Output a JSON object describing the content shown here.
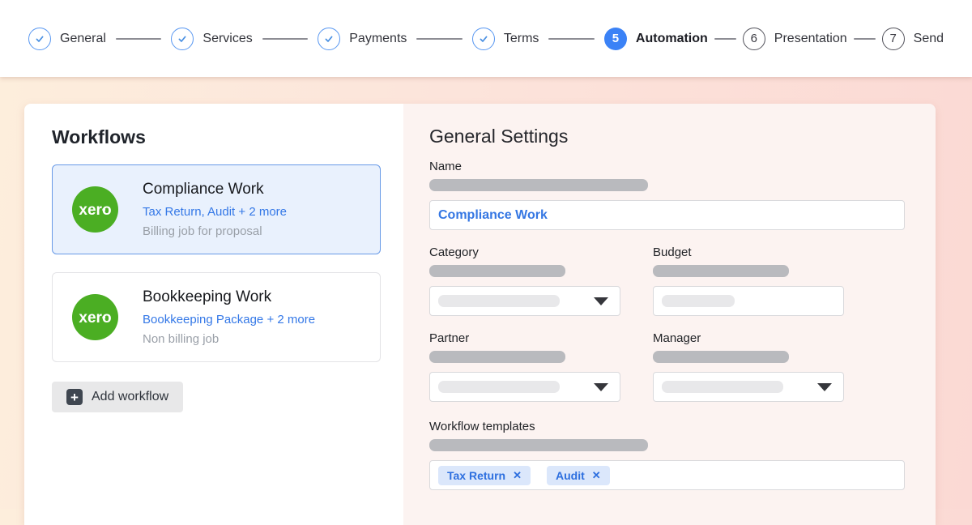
{
  "stepper": {
    "steps": [
      {
        "label": "General",
        "state": "completed"
      },
      {
        "label": "Services",
        "state": "completed"
      },
      {
        "label": "Payments",
        "state": "completed"
      },
      {
        "label": "Terms",
        "state": "completed"
      },
      {
        "label": "Automation",
        "state": "active",
        "number": "5"
      },
      {
        "label": "Presentation",
        "state": "upcoming",
        "number": "6"
      },
      {
        "label": "Send",
        "state": "upcoming",
        "number": "7"
      }
    ]
  },
  "workflows": {
    "title": "Workflows",
    "items": [
      {
        "logo_text": "xero",
        "title": "Compliance Work",
        "subtitle": "Tax Return, Audit + 2 more",
        "description": "Billing job for proposal",
        "selected": true
      },
      {
        "logo_text": "xero",
        "title": "Bookkeeping Work",
        "subtitle": "Bookkeeping Package + 2 more",
        "description": "Non billing job",
        "selected": false
      }
    ],
    "add_button_label": "Add workflow"
  },
  "settings": {
    "title": "General Settings",
    "fields": {
      "name": {
        "label": "Name",
        "value": "Compliance Work"
      },
      "category": {
        "label": "Category"
      },
      "budget": {
        "label": "Budget"
      },
      "partner": {
        "label": "Partner"
      },
      "manager": {
        "label": "Manager"
      },
      "templates": {
        "label": "Workflow templates",
        "chips": [
          "Tax Return",
          "Audit"
        ]
      }
    }
  },
  "icons": {
    "plus": "+",
    "chip_remove": "✕"
  },
  "colors": {
    "accent_blue": "#3b82f6",
    "link_blue": "#3577e3",
    "chip_bg": "#dbe7fb",
    "xero_green": "#4bae23",
    "selected_card_bg": "#e9f1fd",
    "selected_card_border": "#689ae7",
    "panel_pink": "#fcf3f1",
    "page_gradient_left": "#fdeedc",
    "page_gradient_right": "#fbd9d4"
  }
}
